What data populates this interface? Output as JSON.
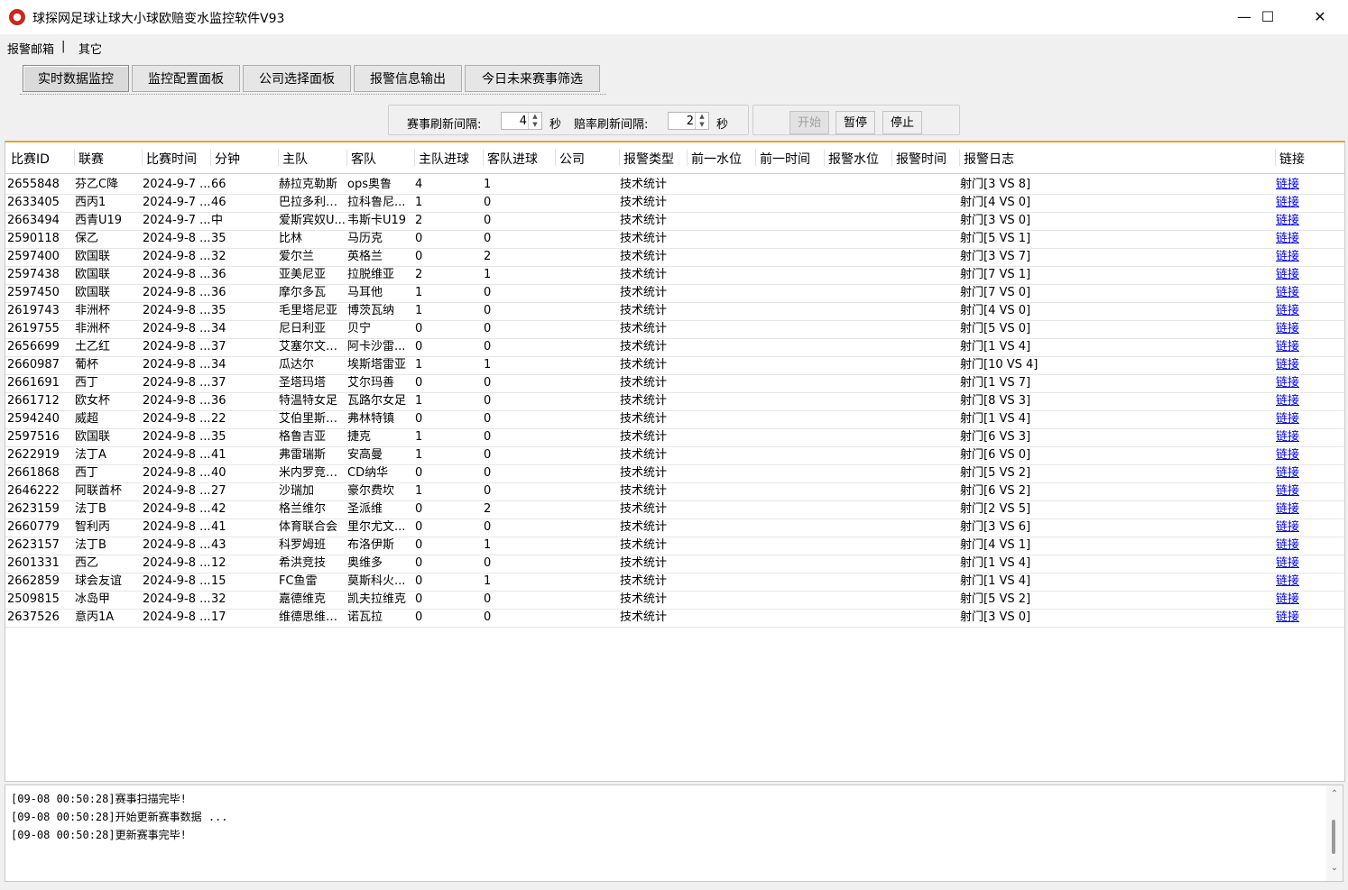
{
  "window": {
    "title": "球探网足球让球大小球欧赔变水监控软件V93",
    "icon": "app-logo-icon",
    "controls": {
      "minimize": "—",
      "maximize": "☐",
      "close": "✕"
    }
  },
  "menu": {
    "items": [
      {
        "label": "报警邮箱"
      },
      {
        "label": "|"
      },
      {
        "label": "其它"
      }
    ]
  },
  "tabs": [
    {
      "label": "实时数据监控",
      "active": true
    },
    {
      "label": "监控配置面板"
    },
    {
      "label": "公司选择面板"
    },
    {
      "label": "报警信息输出"
    },
    {
      "label": "今日未来赛事筛选"
    }
  ],
  "controls": {
    "match_refresh_label": "赛事刷新间隔:",
    "match_refresh_value": "4",
    "match_refresh_unit": "秒",
    "odds_refresh_label": "赔率刷新间隔:",
    "odds_refresh_value": "2",
    "odds_refresh_unit": "秒",
    "start_label": "开始",
    "pause_label": "暂停",
    "stop_label": "停止"
  },
  "table": {
    "columns": [
      "比赛ID",
      "联赛",
      "比赛时间",
      "分钟",
      "主队",
      "客队",
      "主队进球",
      "客队进球",
      "公司",
      "报警类型",
      "前一水位",
      "前一时间",
      "报警水位",
      "报警时间",
      "报警日志",
      "链接"
    ],
    "rows": [
      [
        "2655848",
        "芬乙C降",
        "2024-9-7 ...",
        "66",
        "赫拉克勒斯",
        "ops奥鲁",
        "4",
        "1",
        "",
        "技术统计",
        "",
        "",
        "",
        "",
        "射门[3 VS 8]",
        "链接"
      ],
      [
        "2633405",
        "西丙1",
        "2024-9-7 ...",
        "46",
        "巴拉多利德...",
        "拉科鲁尼...",
        "1",
        "0",
        "",
        "技术统计",
        "",
        "",
        "",
        "",
        "射门[4 VS 0]",
        "链接"
      ],
      [
        "2663494",
        "西青U19",
        "2024-9-7 ...",
        "中",
        "爱斯宾奴U...",
        "韦斯卡U19",
        "2",
        "0",
        "",
        "技术统计",
        "",
        "",
        "",
        "",
        "射门[3 VS 0]",
        "链接"
      ],
      [
        "2590118",
        "保乙",
        "2024-9-8 ...",
        "35",
        "比林",
        "马历克",
        "0",
        "0",
        "",
        "技术统计",
        "",
        "",
        "",
        "",
        "射门[5 VS 1]",
        "链接"
      ],
      [
        "2597400",
        "欧国联",
        "2024-9-8 ...",
        "32",
        "爱尔兰",
        "英格兰",
        "0",
        "2",
        "",
        "技术统计",
        "",
        "",
        "",
        "",
        "射门[3 VS 7]",
        "链接"
      ],
      [
        "2597438",
        "欧国联",
        "2024-9-8 ...",
        "36",
        "亚美尼亚",
        "拉脱维亚",
        "2",
        "1",
        "",
        "技术统计",
        "",
        "",
        "",
        "",
        "射门[7 VS 1]",
        "链接"
      ],
      [
        "2597450",
        "欧国联",
        "2024-9-8 ...",
        "36",
        "摩尔多瓦",
        "马耳他",
        "1",
        "0",
        "",
        "技术统计",
        "",
        "",
        "",
        "",
        "射门[7 VS 0]",
        "链接"
      ],
      [
        "2619743",
        "非洲杯",
        "2024-9-8 ...",
        "35",
        "毛里塔尼亚",
        "博茨瓦纳",
        "1",
        "0",
        "",
        "技术统计",
        "",
        "",
        "",
        "",
        "射门[4 VS 0]",
        "链接"
      ],
      [
        "2619755",
        "非洲杯",
        "2024-9-8 ...",
        "34",
        "尼日利亚",
        "贝宁",
        "0",
        "0",
        "",
        "技术统计",
        "",
        "",
        "",
        "",
        "射门[5 VS 0]",
        "链接"
      ],
      [
        "2656699",
        "土乙红",
        "2024-9-8 ...",
        "37",
        "艾塞尔文得...",
        "阿卡沙雷...",
        "0",
        "0",
        "",
        "技术统计",
        "",
        "",
        "",
        "",
        "射门[1 VS 4]",
        "链接"
      ],
      [
        "2660987",
        "葡杯",
        "2024-9-8 ...",
        "34",
        "瓜达尔",
        "埃斯塔雷亚",
        "1",
        "1",
        "",
        "技术统计",
        "",
        "",
        "",
        "",
        "射门[10 VS 4]",
        "链接"
      ],
      [
        "2661691",
        "西丁",
        "2024-9-8 ...",
        "37",
        "圣塔玛塔",
        "艾尔玛善",
        "0",
        "0",
        "",
        "技术统计",
        "",
        "",
        "",
        "",
        "射门[1 VS 7]",
        "链接"
      ],
      [
        "2661712",
        "欧女杯",
        "2024-9-8 ...",
        "36",
        "特温特女足",
        "瓦路尔女足",
        "1",
        "0",
        "",
        "技术统计",
        "",
        "",
        "",
        "",
        "射门[8 VS 3]",
        "链接"
      ],
      [
        "2594240",
        "威超",
        "2024-9-8 ...",
        "22",
        "艾伯里斯特...",
        "弗林特镇",
        "0",
        "0",
        "",
        "技术统计",
        "",
        "",
        "",
        "",
        "射门[1 VS 4]",
        "链接"
      ],
      [
        "2597516",
        "欧国联",
        "2024-9-8 ...",
        "35",
        "格鲁吉亚",
        "捷克",
        "1",
        "0",
        "",
        "技术统计",
        "",
        "",
        "",
        "",
        "射门[6 VS 3]",
        "链接"
      ],
      [
        "2622919",
        "法丁A",
        "2024-9-8 ...",
        "41",
        "弗雷瑞斯",
        "安高曼",
        "1",
        "0",
        "",
        "技术统计",
        "",
        "",
        "",
        "",
        "射门[6 VS 0]",
        "链接"
      ],
      [
        "2661868",
        "西丁",
        "2024-9-8 ...",
        "40",
        "米内罗竞技...",
        "CD纳华",
        "0",
        "0",
        "",
        "技术统计",
        "",
        "",
        "",
        "",
        "射门[5 VS 2]",
        "链接"
      ],
      [
        "2646222",
        "阿联酋杯",
        "2024-9-8 ...",
        "27",
        "沙瑞加",
        "豪尔费坎",
        "1",
        "0",
        "",
        "技术统计",
        "",
        "",
        "",
        "",
        "射门[6 VS 2]",
        "链接"
      ],
      [
        "2623159",
        "法丁B",
        "2024-9-8 ...",
        "42",
        "格兰维尔",
        "圣派维",
        "0",
        "2",
        "",
        "技术统计",
        "",
        "",
        "",
        "",
        "射门[2 VS 5]",
        "链接"
      ],
      [
        "2660779",
        "智利丙",
        "2024-9-8 ...",
        "41",
        "体育联合会",
        "里尔尤文...",
        "0",
        "0",
        "",
        "技术统计",
        "",
        "",
        "",
        "",
        "射门[3 VS 6]",
        "链接"
      ],
      [
        "2623157",
        "法丁B",
        "2024-9-8 ...",
        "43",
        "科罗姆班",
        "布洛伊斯",
        "0",
        "1",
        "",
        "技术统计",
        "",
        "",
        "",
        "",
        "射门[4 VS 1]",
        "链接"
      ],
      [
        "2601331",
        "西乙",
        "2024-9-8 ...",
        "12",
        "希洪竞技",
        "奥维多",
        "0",
        "0",
        "",
        "技术统计",
        "",
        "",
        "",
        "",
        "射门[1 VS 4]",
        "链接"
      ],
      [
        "2662859",
        "球会友谊",
        "2024-9-8 ...",
        "15",
        "FC鱼雷",
        "莫斯科火...",
        "0",
        "1",
        "",
        "技术统计",
        "",
        "",
        "",
        "",
        "射门[1 VS 4]",
        "链接"
      ],
      [
        "2509815",
        "冰岛甲",
        "2024-9-8 ...",
        "32",
        "嘉德维克",
        "凯夫拉维克",
        "0",
        "0",
        "",
        "技术统计",
        "",
        "",
        "",
        "",
        "射门[5 VS 2]",
        "链接"
      ],
      [
        "2637526",
        "意丙1A",
        "2024-9-8 ...",
        "17",
        "维德思维罗...",
        "诺瓦拉",
        "0",
        "0",
        "",
        "技术统计",
        "",
        "",
        "",
        "",
        "射门[3 VS 0]",
        "链接"
      ]
    ]
  },
  "log": {
    "lines": [
      "[09-08 00:50:28]赛事扫描完毕!",
      "[09-08 00:50:28]开始更新赛事数据 ...",
      "[09-08 00:50:28]更新赛事完毕!"
    ]
  },
  "colors": {
    "link": "#0000ee",
    "grid_top_border": "#f0a030",
    "app_icon": "#c8281e"
  }
}
